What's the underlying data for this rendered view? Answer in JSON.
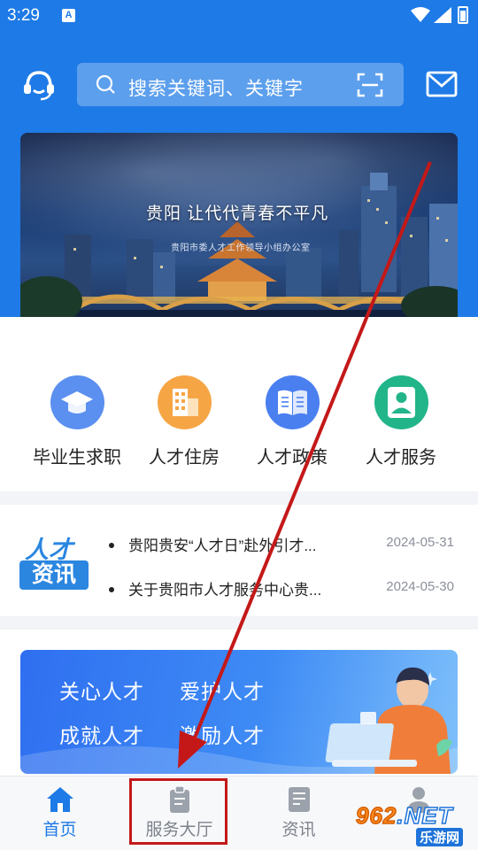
{
  "status": {
    "time": "3:29",
    "badge": "A"
  },
  "search": {
    "placeholder": "搜索关键词、关键字"
  },
  "banner": {
    "slogan": "贵阳  让代代青春不平凡",
    "sub": "贵阳市委人才工作领导小组办公室",
    "slide_count": 5,
    "active_slide": 2
  },
  "categories": [
    {
      "label": "毕业生求职",
      "icon": "graduation-cap-icon",
      "color": "#5b8ff0"
    },
    {
      "label": "人才住房",
      "icon": "building-icon",
      "color": "#f6a545"
    },
    {
      "label": "人才政策",
      "icon": "open-book-icon",
      "color": "#4a7ff0"
    },
    {
      "label": "人才服务",
      "icon": "person-service-icon",
      "color": "#22b58a"
    }
  ],
  "news": {
    "logo_top": "人才",
    "logo_bottom": "资讯",
    "items": [
      {
        "title": "贵阳贵安“人才日”赴外引才...",
        "date": "2024-05-31"
      },
      {
        "title": "关于贵阳市人才服务中心贵...",
        "date": "2024-05-30"
      }
    ]
  },
  "promo": {
    "lines": [
      "关心人才",
      "爱护人才",
      "成就人才",
      "激励人才"
    ]
  },
  "tabs": [
    {
      "label": "首页",
      "icon": "home-icon",
      "active": true
    },
    {
      "label": "服务大厅",
      "icon": "clipboard-icon",
      "active": false
    },
    {
      "label": "资讯",
      "icon": "news-doc-icon",
      "active": false
    },
    {
      "label": "",
      "icon": "person-icon",
      "active": false
    }
  ],
  "watermark": {
    "number": "962",
    "net": ".NET",
    "site": "乐游网"
  },
  "colors": {
    "brand": "#1e7ae6",
    "annotation": "#c41818"
  }
}
